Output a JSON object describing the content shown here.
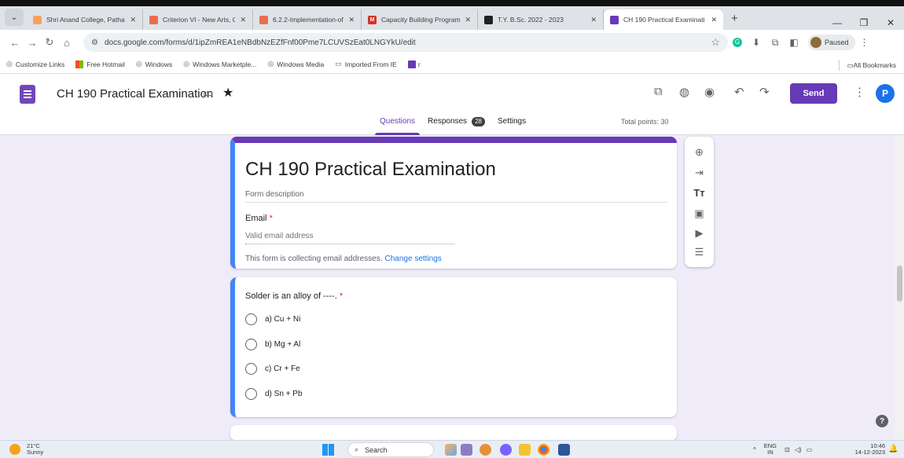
{
  "browser": {
    "tabs": [
      {
        "label": "Shri Anand College, Pathar",
        "color": "#f4a261",
        "active": false
      },
      {
        "label": "Criterion VI - New Arts, Co",
        "color": "#e76f51",
        "active": false
      },
      {
        "label": "6.2.2-Implementation-of-e",
        "color": "#e76f51",
        "active": false
      },
      {
        "label": "Capacity Building Program",
        "color": "#d93025",
        "glyph": "M",
        "active": false
      },
      {
        "label": "T.Y. B.Sc. 2022 - 2023",
        "color": "#202124",
        "active": false
      },
      {
        "label": "CH 190 Practical Examinati",
        "color": "#673ab7",
        "active": true
      }
    ],
    "url": "docs.google.com/forms/d/1ipZmREA1eNBdbNzEZfFnf00Pme7LCUVSzEat0LNGYkU/edit",
    "profile_label": "Paused",
    "bookmarks": [
      "Customize Links",
      "Free Hotmail",
      "Windows",
      "Windows Marketple...",
      "Windows Media",
      "Imported From IE",
      "r"
    ],
    "all_bookmarks": "All Bookmarks"
  },
  "forms_header": {
    "doc_title": "CH 190 Practical Examination",
    "send_label": "Send",
    "avatar_letter": "P",
    "tabs": {
      "questions": "Questions",
      "responses": "Responses",
      "responses_count": "28",
      "settings": "Settings"
    },
    "total_points": "Total points: 30",
    "accent": "#673ab7"
  },
  "form": {
    "title": "CH 190 Practical Examination",
    "description_placeholder": "Form description",
    "email_label": "Email",
    "required_mark": "*",
    "email_placeholder": "Valid email address",
    "collect_note": "This form is collecting email addresses.",
    "change_settings": "Change settings"
  },
  "question": {
    "text": "Solder is an alloy of ----.",
    "required_mark": "*",
    "options": [
      "a) Cu + Ni",
      "b) Mg + Al",
      "c) Cr + Fe",
      "d) Sn + Pb"
    ]
  },
  "taskbar": {
    "temperature": "21°C",
    "weather": "Sunny",
    "search_label": "Search",
    "lang_top": "ENG",
    "lang_bottom": "IN",
    "time": "10:46",
    "date": "14-12-2023"
  }
}
